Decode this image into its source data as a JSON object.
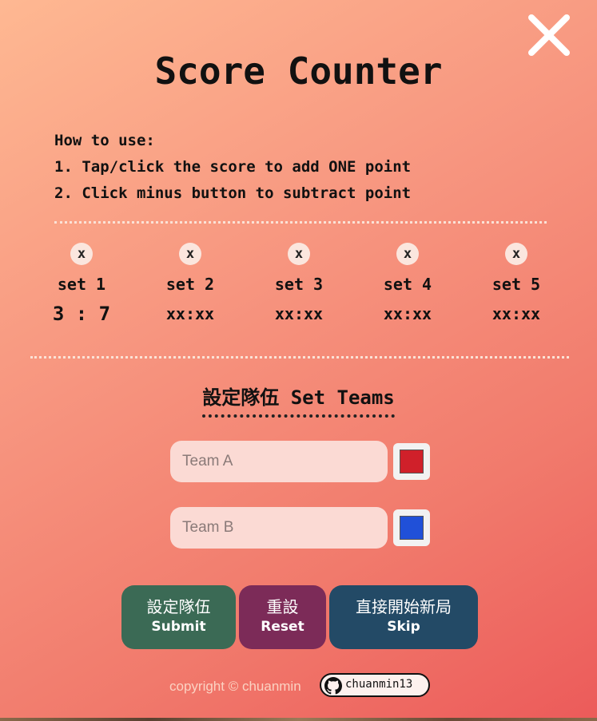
{
  "title": "Score Counter",
  "close_icon": "close-icon",
  "howto": {
    "heading": "How to use:",
    "step1": "1. Tap/click the score to add ONE point",
    "step2": "2. Click minus button to subtract point"
  },
  "sets": [
    {
      "remove": "x",
      "label": "set 1",
      "score": "3 : 7"
    },
    {
      "remove": "x",
      "label": "set 2",
      "score": "xx:xx"
    },
    {
      "remove": "x",
      "label": "set 3",
      "score": "xx:xx"
    },
    {
      "remove": "x",
      "label": "set 4",
      "score": "xx:xx"
    },
    {
      "remove": "x",
      "label": "set 5",
      "score": "xx:xx"
    }
  ],
  "teams": {
    "heading": "設定隊伍 Set Teams",
    "team_a": {
      "placeholder": "Team A",
      "value": "",
      "color": "#d0202a"
    },
    "team_b": {
      "placeholder": "Team B",
      "value": "",
      "color": "#2050d8"
    }
  },
  "buttons": {
    "submit": {
      "zh": "設定隊伍",
      "en": "Submit",
      "color": "#3b6a55"
    },
    "reset": {
      "zh": "重設",
      "en": "Reset",
      "color": "#7c2b58"
    },
    "skip": {
      "zh": "直接開始新局",
      "en": "Skip",
      "color": "#234a66"
    }
  },
  "footer": {
    "copyright": "copyright © chuanmin",
    "github_user": "chuanmin13",
    "github_icon": "github-icon"
  }
}
